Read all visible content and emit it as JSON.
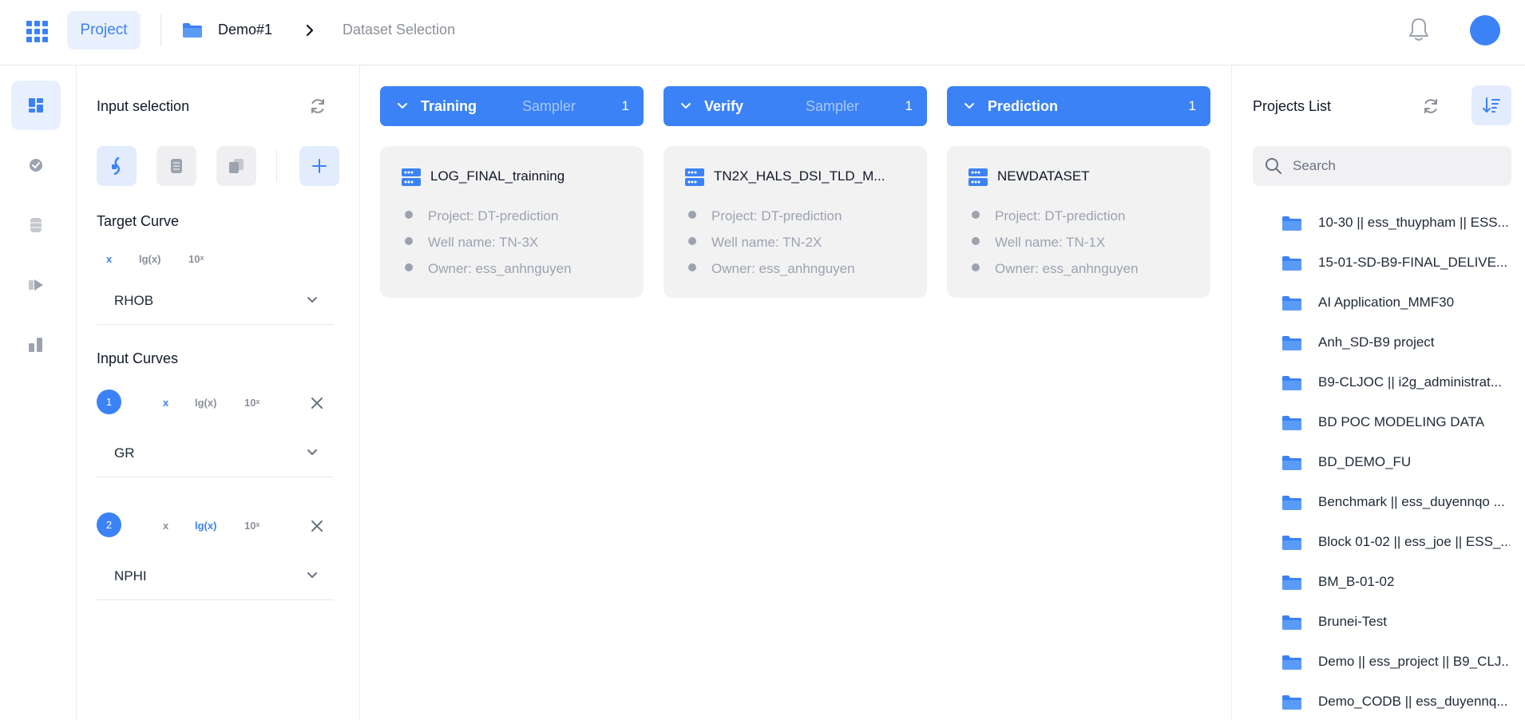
{
  "header": {
    "tab_project": "Project",
    "breadcrumb": [
      "Demo#1",
      "Dataset Selection"
    ]
  },
  "colors": {
    "accent": "#3b82f6",
    "accent_light": "#e8f0fd",
    "card_bg": "#f2f2f3"
  },
  "icons": {
    "apps": "grid-icon",
    "bell": "bell-icon",
    "folder": "folder-icon",
    "rail": [
      "dashboard-icon",
      "check-circle-icon",
      "database-icon",
      "play-icon",
      "chart-icon"
    ]
  },
  "input_panel": {
    "title": "Input selection",
    "target_curve": {
      "label": "Target Curve",
      "modes": [
        "x",
        "lg(x)",
        "10ˣ"
      ],
      "active_mode": "x",
      "value": "RHOB"
    },
    "input_curves": {
      "label": "Input Curves",
      "items": [
        {
          "index": "1",
          "modes": [
            "x",
            "lg(x)",
            "10ˣ"
          ],
          "active_mode": "x",
          "value": "GR"
        },
        {
          "index": "2",
          "modes": [
            "x",
            "lg(x)",
            "10ˣ"
          ],
          "active_mode": "lg(x)",
          "value": "NPHI"
        }
      ]
    }
  },
  "columns": [
    {
      "label": "Training",
      "sampler": "Sampler",
      "count": "1",
      "dataset": {
        "name": "LOG_FINAL_trainning",
        "project": "Project: DT-prediction",
        "well": "Well name: TN-3X",
        "owner": "Owner: ess_anhnguyen"
      }
    },
    {
      "label": "Verify",
      "sampler": "Sampler",
      "count": "1",
      "dataset": {
        "name": "TN2X_HALS_DSI_TLD_M...",
        "project": "Project: DT-prediction",
        "well": "Well name: TN-2X",
        "owner": "Owner: ess_anhnguyen"
      }
    },
    {
      "label": "Prediction",
      "sampler": "",
      "count": "1",
      "dataset": {
        "name": "NEWDATASET",
        "project": "Project: DT-prediction",
        "well": "Well name: TN-1X",
        "owner": "Owner: ess_anhnguyen"
      }
    }
  ],
  "projects_list": {
    "title": "Projects List",
    "search_placeholder": "Search",
    "items": [
      "10-30 || ess_thuypham || ESS...",
      "15-01-SD-B9-FINAL_DELIVE...",
      "AI Application_MMF30",
      "Anh_SD-B9 project",
      "B9-CLJOC || i2g_administrat...",
      "BD POC MODELING DATA",
      "BD_DEMO_FU",
      "Benchmark || ess_duyennqo ...",
      "Block 01-02 || ess_joe || ESS_...",
      "BM_B-01-02",
      "Brunei-Test",
      "Demo || ess_project || B9_CLJ...",
      "Demo_CODB || ess_duyennq..."
    ]
  }
}
